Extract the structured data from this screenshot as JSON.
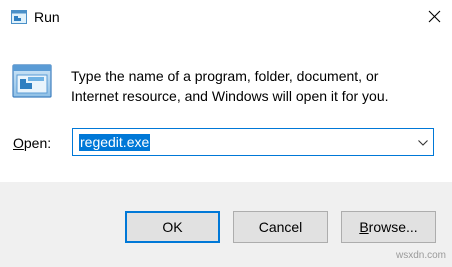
{
  "window": {
    "title": "Run",
    "title_icon": "run-icon",
    "close_icon": "close-icon"
  },
  "body": {
    "icon": "run-icon",
    "description_line1": "Type the name of a program, folder, document, or",
    "description_line2": "Internet resource, and Windows will open it for you."
  },
  "open_field": {
    "label_accel": "O",
    "label_rest": "pen:",
    "value": "regedit.exe",
    "dropdown_icon": "chevron-down-icon"
  },
  "buttons": {
    "ok": "OK",
    "cancel": "Cancel",
    "browse_accel": "B",
    "browse_rest": "rowse..."
  },
  "watermark": "wsxdn.com",
  "colors": {
    "accent": "#0078d7",
    "button_bar_bg": "#f0f0f0",
    "button_bg": "#e1e1e1",
    "button_border": "#adadad"
  }
}
